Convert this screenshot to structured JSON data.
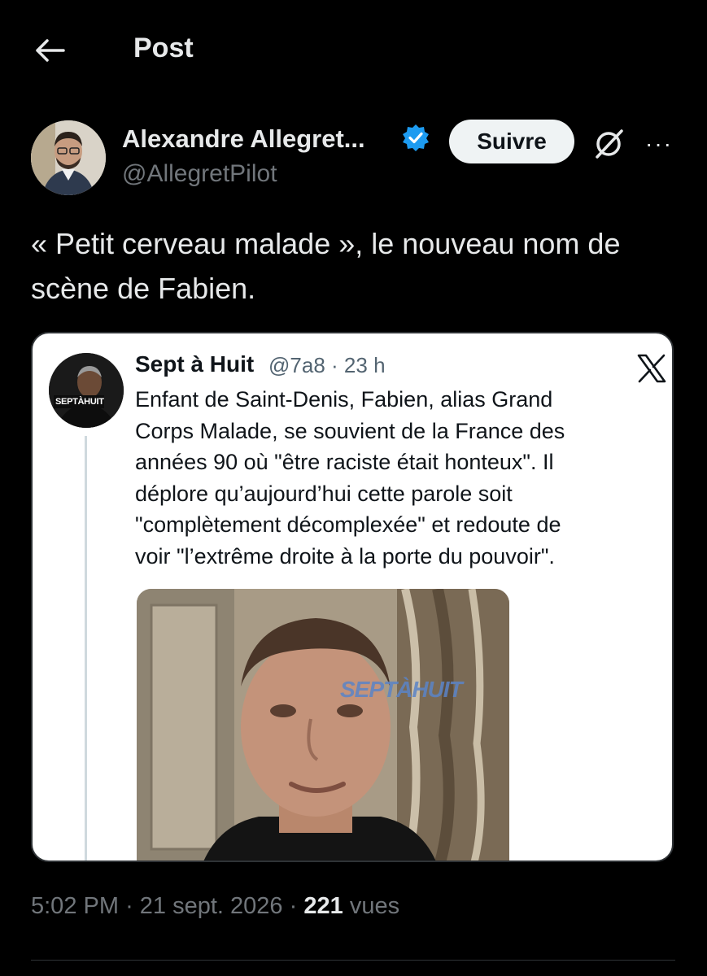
{
  "header": {
    "title": "Post",
    "back_icon": "arrow-left-icon"
  },
  "author": {
    "display_name": "Alexandre Allegret...",
    "handle": "@AllegretPilot",
    "verified_icon": "verified-badge-icon",
    "verified_color": "#1d9bf0",
    "follow_label": "Suivre",
    "grok_icon": "grok-icon",
    "more_icon": "more-horizontal-icon",
    "more_label": "···"
  },
  "post": {
    "text_line1": "« Petit cerveau malade », le nouveau nom de",
    "text_line2": "scène de Fabien."
  },
  "quote": {
    "name": "Sept à Huit",
    "handle": "@7a8",
    "age": "23 h",
    "x_icon": "x-logo-icon",
    "avatar_label": "SEPTÀHUIT",
    "lines": [
      "Enfant de Saint-Denis, Fabien, alias Grand",
      "Corps Malade, se souvient de la France des",
      "années 90 où \"être raciste était honteux\". Il",
      "déplore qu’aujourd’hui cette parole soit",
      "\"complètement décomplexée\" et redoute de",
      "voir \"l’extrême droite à la porte du pouvoir\"."
    ],
    "media_watermark": "SEPTÀHUIT"
  },
  "meta": {
    "time": "5:02 PM",
    "date": "21 sept. 2026",
    "views_count": "221",
    "views_label": "vues",
    "separator": "·"
  },
  "colors": {
    "background": "#000000",
    "text_primary": "#e7e9ea",
    "text_secondary": "#71767b",
    "follow_bg": "#eff3f4"
  }
}
